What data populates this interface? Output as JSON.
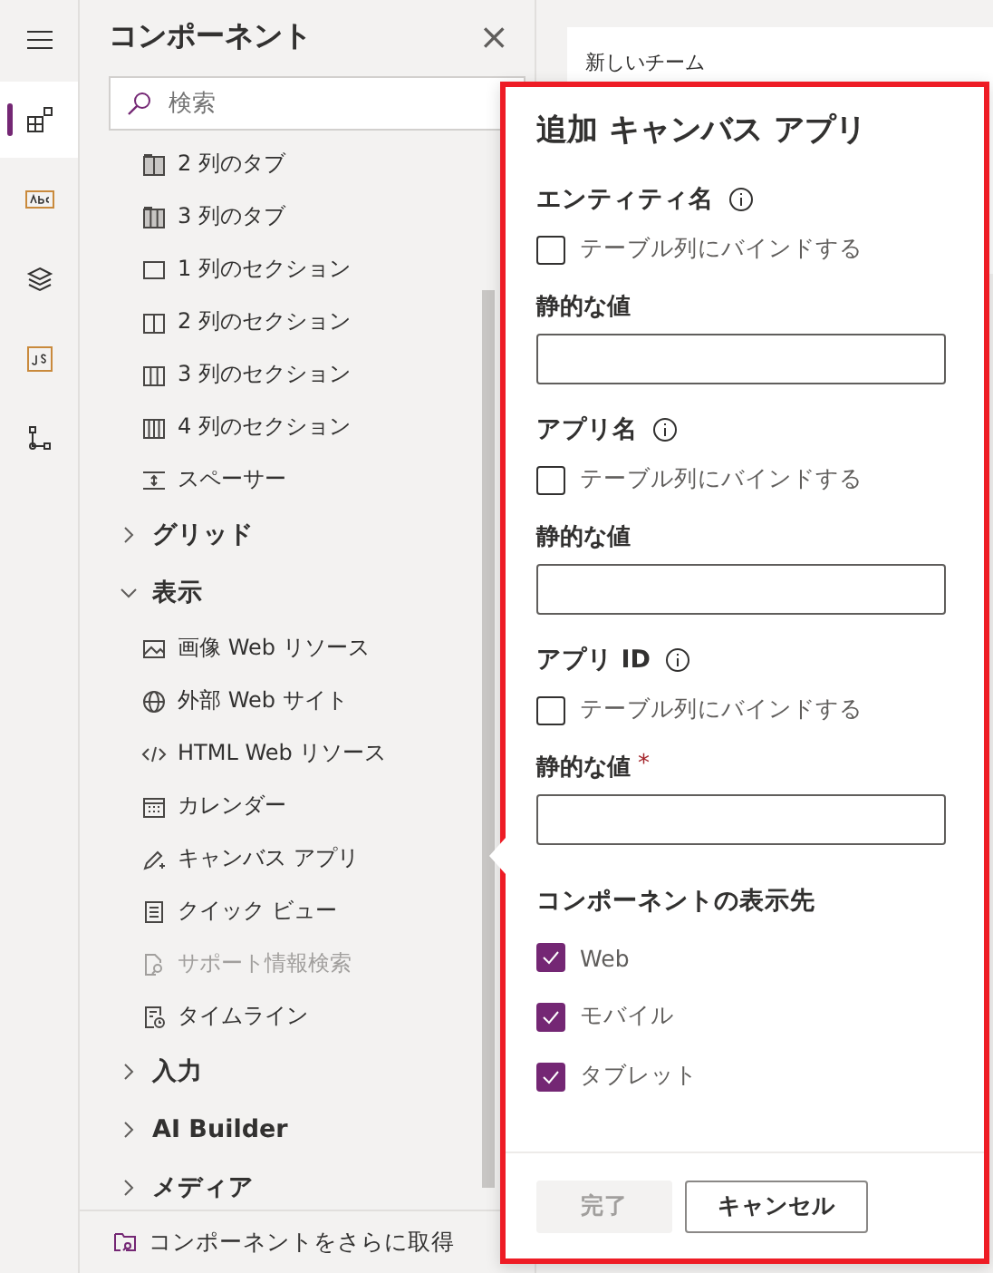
{
  "rail": [
    {
      "selected": false
    },
    {
      "selected": true
    },
    {
      "selected": false
    },
    {
      "selected": false
    },
    {
      "selected": false
    },
    {
      "selected": false
    }
  ],
  "sidebar": {
    "title": "コンポーネント",
    "close": "×",
    "search": {
      "placeholder": "検索"
    },
    "items": [
      {
        "kind": "item",
        "label": "2 列のタブ",
        "disabled": false
      },
      {
        "kind": "item",
        "label": "3 列のタブ",
        "disabled": false
      },
      {
        "kind": "item",
        "label": "1 列のセクション",
        "disabled": false
      },
      {
        "kind": "item",
        "label": "2 列のセクション",
        "disabled": false
      },
      {
        "kind": "item",
        "label": "3 列のセクション",
        "disabled": false
      },
      {
        "kind": "item",
        "label": "4 列のセクション",
        "disabled": false
      },
      {
        "kind": "item",
        "label": "スペーサー",
        "disabled": false
      },
      {
        "kind": "group",
        "label": "グリッド",
        "expanded": false
      },
      {
        "kind": "group",
        "label": "表示",
        "expanded": true
      },
      {
        "kind": "item",
        "label": "画像 Web リソース",
        "disabled": false
      },
      {
        "kind": "item",
        "label": "外部 Web サイト",
        "disabled": false
      },
      {
        "kind": "item",
        "label": "HTML Web リソース",
        "disabled": false
      },
      {
        "kind": "item",
        "label": "カレンダー",
        "disabled": false
      },
      {
        "kind": "item",
        "label": "キャンバス アプリ",
        "disabled": false
      },
      {
        "kind": "item",
        "label": "クイック ビュー",
        "disabled": false
      },
      {
        "kind": "item",
        "label": "サポート情報検索",
        "disabled": true
      },
      {
        "kind": "item",
        "label": "タイムライン",
        "disabled": false
      },
      {
        "kind": "group",
        "label": "入力",
        "expanded": false
      },
      {
        "kind": "group",
        "label": "AI Builder",
        "expanded": false
      },
      {
        "kind": "group",
        "label": "メディア",
        "expanded": false
      }
    ],
    "footer_link": "コンポーネントをさらに取得"
  },
  "canvas": {
    "card_title": "新しいチーム"
  },
  "dialog": {
    "title": "追加 キャンバス アプリ",
    "fields": [
      {
        "label": "エンティティ名",
        "bind_label": "テーブル列にバインドする",
        "bind_checked": false,
        "value_label": "静的な値"
      },
      {
        "label": "アプリ名",
        "bind_label": "テーブル列にバインドする",
        "bind_checked": false,
        "value_label": "静的な値"
      },
      {
        "label": "アプリ ID",
        "bind_label": "テーブル列にバインドする",
        "bind_checked": false,
        "value_label": "静的な値",
        "required_mark": "*"
      }
    ],
    "targets_title": "コンポーネントの表示先",
    "targets": [
      {
        "label": "Web",
        "checked": true
      },
      {
        "label": "モバイル",
        "checked": true
      },
      {
        "label": "タブレット",
        "checked": true
      }
    ],
    "buttons": [
      {
        "kind": "primary",
        "label": "完了",
        "disabled": true
      },
      {
        "kind": "secondary",
        "label": "キャンセル",
        "disabled": false
      }
    ]
  }
}
